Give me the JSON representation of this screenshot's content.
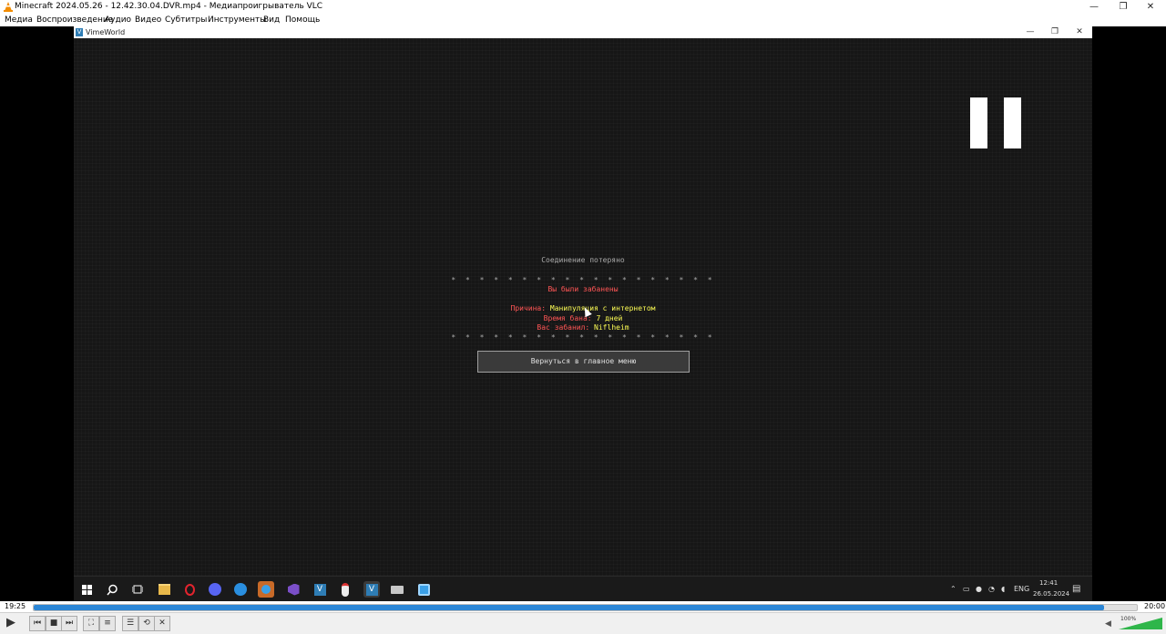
{
  "vlc": {
    "window_title": "Minecraft 2024.05.26 - 12.42.30.04.DVR.mp4 - Медиапроигрыватель VLC",
    "menu": [
      "Медиа",
      "Воспроизведение",
      "Аудио",
      "Видео",
      "Субтитры",
      "Инструменты",
      "Вид",
      "Помощь"
    ],
    "current_time": "19:25",
    "total_time": "20:00",
    "progress_fraction": 0.97,
    "volume": "100%",
    "accent_color": "#2b86d6"
  },
  "game_window": {
    "title": "VimeWorld",
    "icon_letter": "V"
  },
  "disconnect": {
    "header": "Соединение потеряно",
    "stars": "* * * * * * * * * * * * * * * * * * *",
    "banned_title": "Вы были забанены",
    "reason_label": "Причина:",
    "reason_value": "Манипуляция с интернетом",
    "time_label": "Время бана:",
    "time_value": "7 дней",
    "by_label": "Вас забанил:",
    "by_value": "Niflheim",
    "button_label": "Вернуться в главное меню"
  },
  "taskbar": {
    "apps": [
      "start-icon",
      "search-icon",
      "task-view-icon",
      "explorer-icon",
      "opera-icon",
      "discord-icon",
      "browser-icon",
      "app-icon",
      "visual-studio-icon",
      "vimeworld-icon",
      "mouse-app-icon",
      "vimeworld-active-icon",
      "printer-icon",
      "camera-icon"
    ],
    "language": "ENG",
    "clock_time": "12:41",
    "clock_date": "26.05.2024"
  }
}
